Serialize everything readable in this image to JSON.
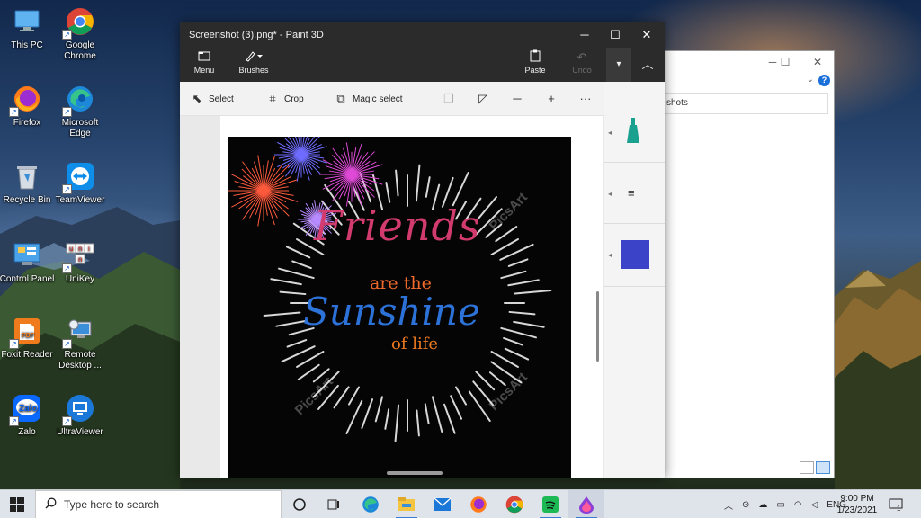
{
  "desktop": {
    "icons": [
      {
        "label": "This PC",
        "icon": "this-pc-icon"
      },
      {
        "label": "Google Chrome",
        "icon": "chrome-icon"
      },
      {
        "label": "Firefox",
        "icon": "firefox-icon"
      },
      {
        "label": "Microsoft Edge",
        "icon": "edge-icon"
      },
      {
        "label": "Recycle Bin",
        "icon": "recycle-bin-icon"
      },
      {
        "label": "TeamViewer",
        "icon": "teamviewer-icon"
      },
      {
        "label": "Control Panel",
        "icon": "control-panel-icon"
      },
      {
        "label": "UniKey",
        "icon": "unikey-icon"
      },
      {
        "label": "Foxit Reader",
        "icon": "foxit-icon"
      },
      {
        "label": "Remote Desktop ...",
        "icon": "remote-desktop-icon"
      },
      {
        "label": "Zalo",
        "icon": "zalo-icon"
      },
      {
        "label": "UltraViewer",
        "icon": "ultraviewer-icon"
      }
    ]
  },
  "explorer": {
    "address_text": "shots"
  },
  "paint": {
    "title": "Screenshot (3).png* - Paint 3D",
    "ribbon": {
      "menu": "Menu",
      "brushes": "Brushes",
      "paste": "Paste",
      "undo": "Undo"
    },
    "toolbar": {
      "select": "Select",
      "crop": "Crop",
      "magic_select": "Magic select",
      "more": "···"
    },
    "side_panel": {
      "color_swatch": "#3b44c8",
      "marker_color": "#1aa08f"
    },
    "canvas": {
      "line1": "Friends",
      "line2": "are the",
      "line3": "Sunshine",
      "line4": "of life",
      "watermark": "PicsArt"
    }
  },
  "taskbar": {
    "search_placeholder": "Type here to search",
    "apps": [
      "cortana",
      "task-view",
      "edge",
      "file-explorer",
      "mail",
      "firefox",
      "chrome",
      "spotify",
      "paint-3d"
    ],
    "language": "ENG",
    "time": "9:00 PM",
    "date": "1/23/2021",
    "notification_count": "1"
  },
  "colors": {
    "accent": "#3a7bd5",
    "paint_title_bg": "#2b2b2b",
    "taskbar_bg": "#dfe3ea"
  }
}
